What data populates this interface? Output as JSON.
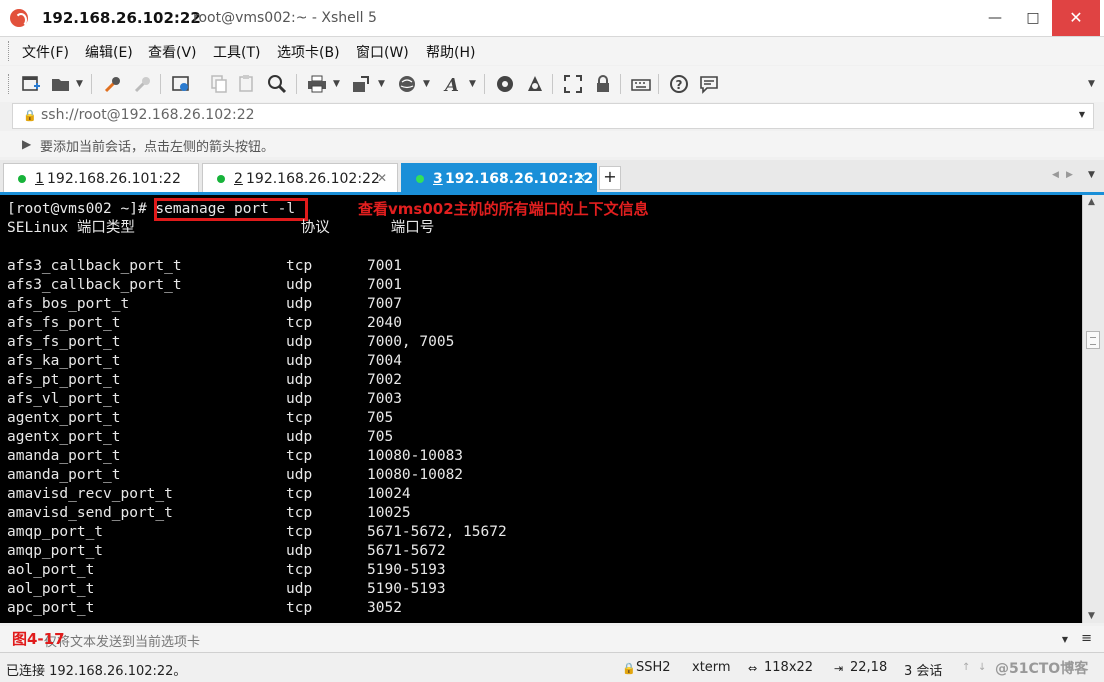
{
  "window": {
    "title_host": "192.168.26.102:22",
    "title_rest": "root@vms002:~ - Xshell 5",
    "minimize": "—",
    "maximize": "□",
    "close": "✕"
  },
  "menu": [
    "文件(F)",
    "编辑(E)",
    "查看(V)",
    "工具(T)",
    "选项卡(B)",
    "窗口(W)",
    "帮助(H)"
  ],
  "toolbar": {
    "icons": [
      "new-session-icon",
      "open-folder-icon",
      "reconnect-icon",
      "disconnect-icon",
      "properties-icon",
      "copy-icon",
      "paste-icon",
      "find-icon",
      "print-icon",
      "transfer-icon",
      "globe-icon",
      "font-icon",
      "xftp-icon",
      "xmanager-icon",
      "fullscreen-icon",
      "lock-icon",
      "keyboard-icon",
      "help-icon",
      "chat-icon"
    ]
  },
  "address": {
    "value": "ssh://root@192.168.26.102:22"
  },
  "hint": {
    "text": "要添加当前会话，点击左侧的箭头按钮。"
  },
  "tabs": [
    {
      "num": "1",
      "host": "192.168.26.101:22",
      "active": false
    },
    {
      "num": "2",
      "host": "192.168.26.102:22",
      "active": false
    },
    {
      "num": "3",
      "host": "192.168.26.102:22",
      "active": true
    }
  ],
  "tab_add": "+",
  "terminal": {
    "prompt": "[root@vms002 ~]# ",
    "command": "semanage port -l",
    "header": "SELinux 端口类型                   协议       端口号",
    "rows": [
      {
        "type": "afs3_callback_port_t",
        "proto": "tcp",
        "ports": "7001"
      },
      {
        "type": "afs3_callback_port_t",
        "proto": "udp",
        "ports": "7001"
      },
      {
        "type": "afs_bos_port_t",
        "proto": "udp",
        "ports": "7007"
      },
      {
        "type": "afs_fs_port_t",
        "proto": "tcp",
        "ports": "2040"
      },
      {
        "type": "afs_fs_port_t",
        "proto": "udp",
        "ports": "7000, 7005"
      },
      {
        "type": "afs_ka_port_t",
        "proto": "udp",
        "ports": "7004"
      },
      {
        "type": "afs_pt_port_t",
        "proto": "udp",
        "ports": "7002"
      },
      {
        "type": "afs_vl_port_t",
        "proto": "udp",
        "ports": "7003"
      },
      {
        "type": "agentx_port_t",
        "proto": "tcp",
        "ports": "705"
      },
      {
        "type": "agentx_port_t",
        "proto": "udp",
        "ports": "705"
      },
      {
        "type": "amanda_port_t",
        "proto": "tcp",
        "ports": "10080-10083"
      },
      {
        "type": "amanda_port_t",
        "proto": "udp",
        "ports": "10080-10082"
      },
      {
        "type": "amavisd_recv_port_t",
        "proto": "tcp",
        "ports": "10024"
      },
      {
        "type": "amavisd_send_port_t",
        "proto": "tcp",
        "ports": "10025"
      },
      {
        "type": "amqp_port_t",
        "proto": "tcp",
        "ports": "5671-5672, 15672"
      },
      {
        "type": "amqp_port_t",
        "proto": "udp",
        "ports": "5671-5672"
      },
      {
        "type": "aol_port_t",
        "proto": "tcp",
        "ports": "5190-5193"
      },
      {
        "type": "aol_port_t",
        "proto": "udp",
        "ports": "5190-5193"
      },
      {
        "type": "apc_port_t",
        "proto": "tcp",
        "ports": "3052"
      }
    ],
    "annotation": "查看vms002主机的所有端口的上下文信息"
  },
  "compose": {
    "figure_label": "图4-17",
    "placeholder": "仅将文本发送到当前选项卡"
  },
  "status": {
    "connection": "已连接 192.168.26.102:22。",
    "protocol": "SSH2",
    "terminal_type": "xterm",
    "size": "118x22",
    "cursor": "22,18",
    "sessions": "3 会话",
    "watermark": "@51CTO博客"
  },
  "colors": {
    "tab_active": "#1a8fd8",
    "annotation": "#e21f1f",
    "terminal_bg": "#000000",
    "terminal_fg": "#e8e8e8",
    "close_button": "#e04343"
  }
}
